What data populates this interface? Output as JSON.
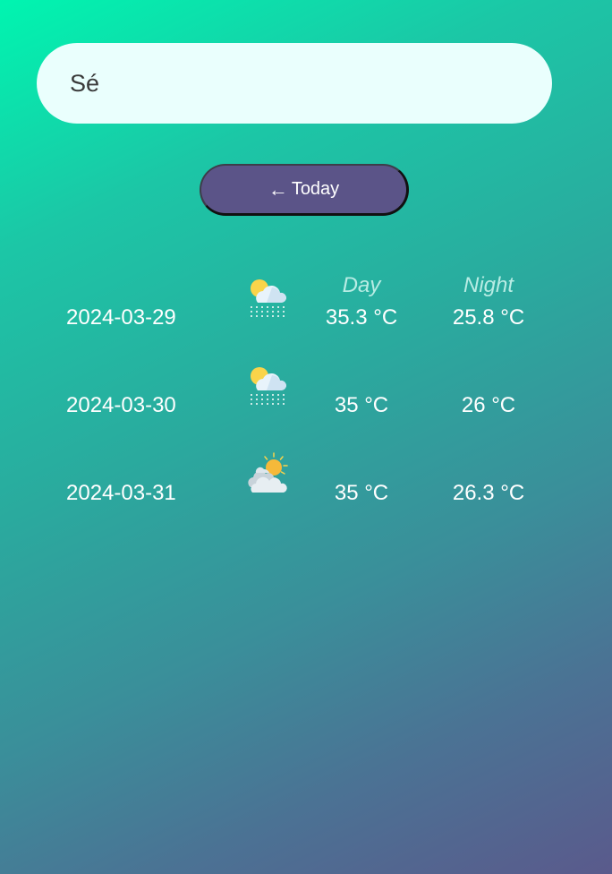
{
  "search": {
    "value": "Sé"
  },
  "today_button": {
    "arrow": "←",
    "label": "Today"
  },
  "columns": {
    "day": "Day",
    "night": "Night"
  },
  "forecast": [
    {
      "date": "2024-03-29",
      "icon": "partly-cloudy-rain-icon",
      "day_temp": "35.3 °C",
      "night_temp": "25.8 °C"
    },
    {
      "date": "2024-03-30",
      "icon": "partly-cloudy-rain-icon",
      "day_temp": "35 °C",
      "night_temp": "26 °C"
    },
    {
      "date": "2024-03-31",
      "icon": "partly-sunny-cloudy-icon",
      "day_temp": "35 °C",
      "night_temp": "26.3 °C"
    }
  ]
}
